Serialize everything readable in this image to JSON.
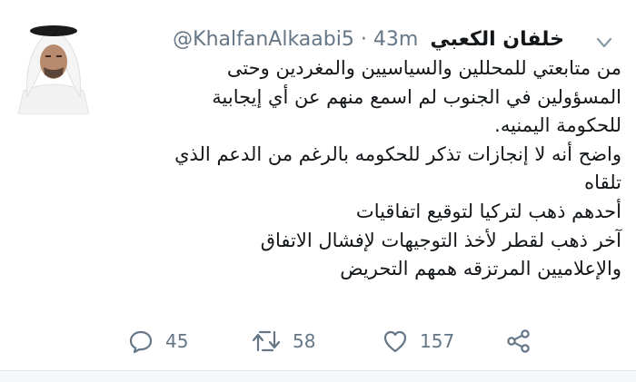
{
  "tweet": {
    "author_name": "خلفان الكعبي",
    "handle": "@KhalfanAlkaabi5",
    "separator": "·",
    "time": "43m",
    "lines": [
      "من متابعتي للمحللين والسياسيين والمغردين وحتى",
      "المسؤولين في الجنوب لم اسمع منهم عن أي إيجابية",
      "للحكومة اليمنيه.",
      "واضح أنه لا إنجازات تذكر للحكومه بالرغم من الدعم الذي",
      "تلقاه",
      "أحدهم ذهب لتركيا لتوقيع اتفاقيات",
      "آخر ذهب لقطر لأخذ التوجيهات لإفشال الاتفاق",
      "والإعلاميين المرتزقه همهم التحريض"
    ]
  },
  "actions": {
    "replies": "45",
    "retweets": "58",
    "likes": "157"
  },
  "icons": {
    "reply": "reply-icon",
    "retweet": "retweet-icon",
    "like": "heart-icon",
    "share": "share-icon",
    "menu": "chevron-down-icon"
  },
  "colors": {
    "text": "#14171a",
    "secondary": "#657786",
    "background": "#ffffff"
  }
}
